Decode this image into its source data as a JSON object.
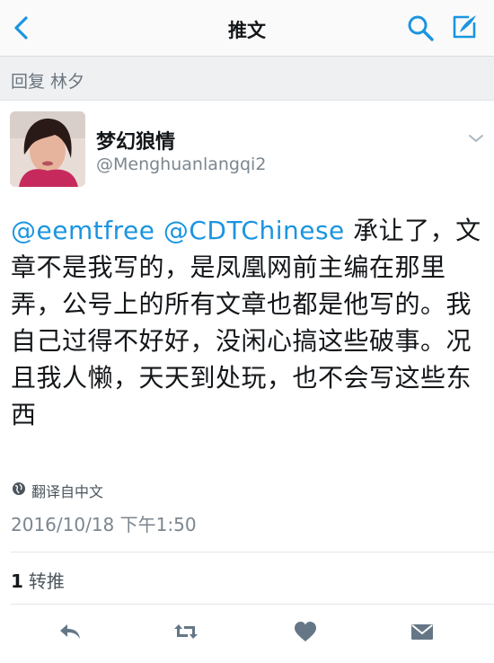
{
  "nav": {
    "title": "推文",
    "back_icon": "back-chevron-icon",
    "search_icon": "search-icon",
    "compose_icon": "compose-icon"
  },
  "reply": {
    "text": "回复 林夕"
  },
  "author": {
    "name": "梦幻狼情",
    "handle": "@Menghuanlangqi2"
  },
  "tweet": {
    "mention1": "@eemtfree",
    "mention2": "@CDTChinese",
    "body": " 承让了，文章不是我写的，是凤凰网前主编在那里弄，公号上的所有文章也都是他写的。我自己过得不好好，没闲心搞这些破事。况且我人懒，天天到处玩，也不会写这些东西"
  },
  "translate": {
    "label": "翻译自中文"
  },
  "timestamp": "2016/10/18 下午1:50",
  "retweets": {
    "count": "1",
    "label": "转推"
  },
  "colors": {
    "accent": "#1b95e0",
    "icon_gray": "#657786"
  }
}
